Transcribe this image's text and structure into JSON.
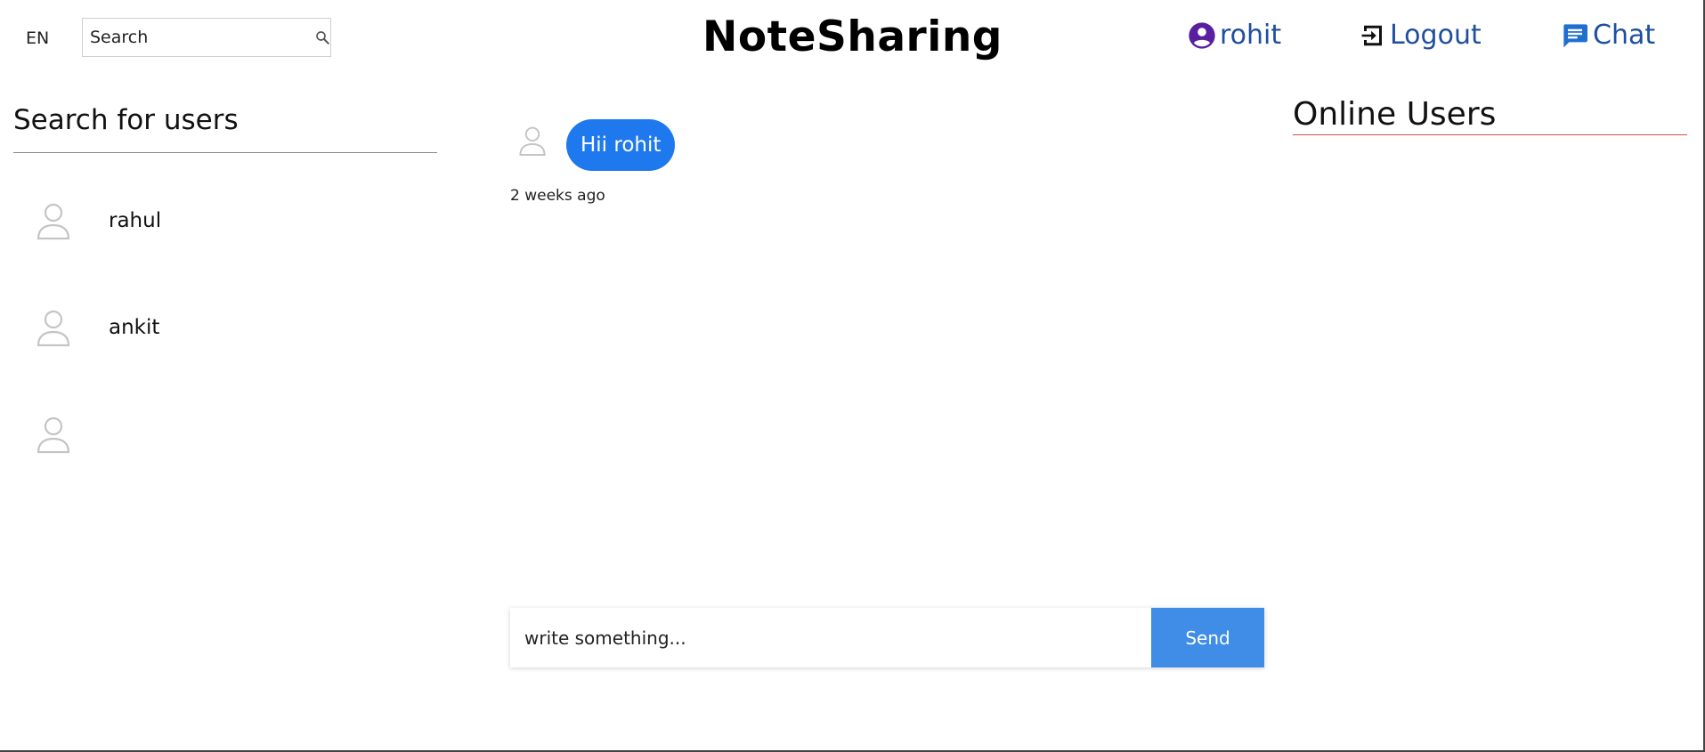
{
  "header": {
    "language": "EN",
    "search_placeholder": "Search",
    "brand": "NoteSharing",
    "nav": {
      "user": "rohit",
      "logout": "Logout",
      "chat": "Chat"
    }
  },
  "left_panel": {
    "title": "Search for users",
    "users": [
      {
        "name": "rahul"
      },
      {
        "name": "ankit"
      },
      {
        "name": ""
      }
    ]
  },
  "chat": {
    "messages": [
      {
        "text": "Hii rohit",
        "time": "2 weeks ago"
      }
    ],
    "input_placeholder": "write something...",
    "send_label": "Send"
  },
  "right_panel": {
    "title": "Online Users"
  },
  "colors": {
    "bubble": "#1e78ee",
    "send_button": "#3f8de6",
    "nav_text": "#1e4fa0",
    "user_icon": "#5a1fa0",
    "online_rule": "#d84a4a"
  },
  "icons": {
    "search": "search-icon",
    "user": "account-circle-icon",
    "logout": "logout-icon",
    "chat": "chat-icon",
    "avatar": "user-outline-icon"
  }
}
